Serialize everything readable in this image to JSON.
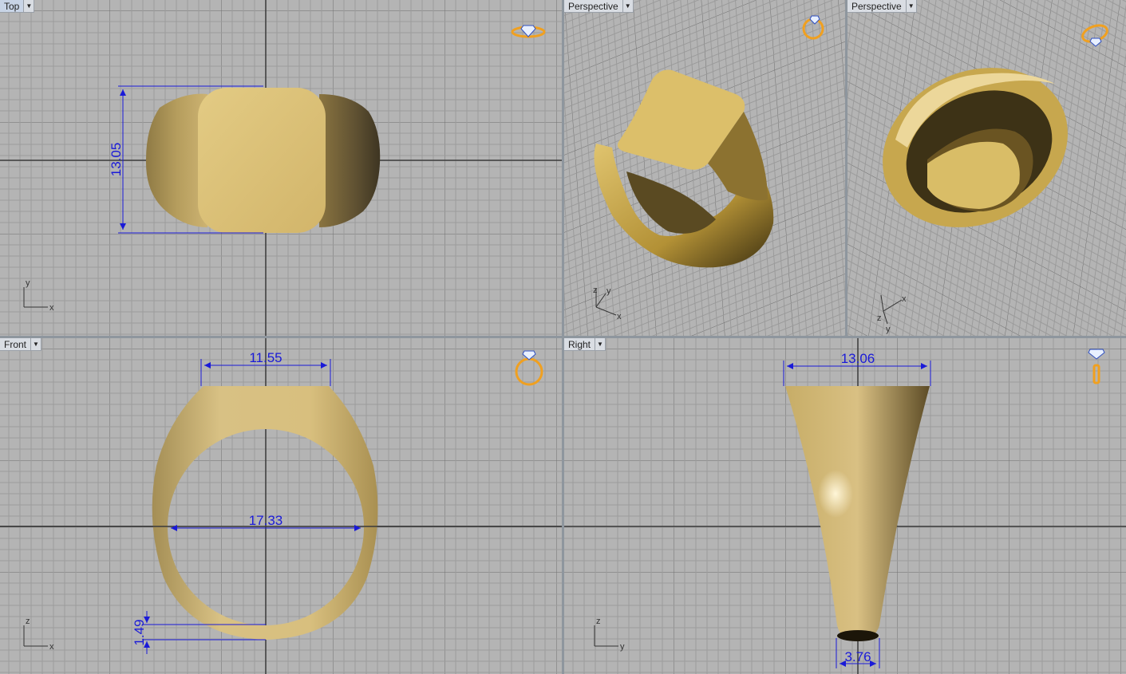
{
  "viewports": {
    "top": {
      "title": "Top",
      "dimension_height": "13.05",
      "axis_x": "x",
      "axis_y": "y",
      "widget_icon": "diamond-ring-icon"
    },
    "perspective_1": {
      "title": "Perspective",
      "axis_x": "x",
      "axis_y": "y",
      "axis_z": "z",
      "widget_icon": "ring-gem-icon"
    },
    "perspective_2": {
      "title": "Perspective",
      "axis_x": "x",
      "axis_y": "y",
      "axis_z": "z",
      "widget_icon": "ring-gem-icon"
    },
    "front": {
      "title": "Front",
      "dimension_top_width": "11.55",
      "dimension_inner_diameter": "17.33",
      "dimension_shank_thickness": "1.49",
      "axis_x": "x",
      "axis_z": "z",
      "widget_icon": "ring-front-icon"
    },
    "right": {
      "title": "Right",
      "dimension_top_width": "13.06",
      "dimension_bottom_width": "3.76",
      "axis_y": "y",
      "axis_z": "z",
      "widget_icon": "ring-side-icon"
    }
  },
  "colors": {
    "viewport_bg": "#b4b4b4",
    "grid_minor": "#9a9a9a",
    "grid_major": "#6e6e6e",
    "gold": "#c9ae66",
    "dimension": "#1a1ad8",
    "widget": "#f0a020"
  }
}
